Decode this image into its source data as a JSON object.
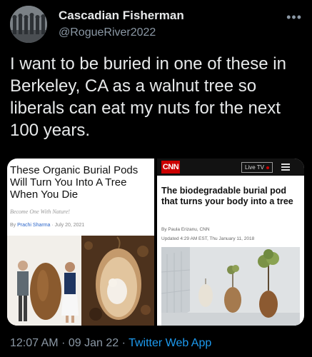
{
  "author": {
    "name": "Cascadian Fisherman",
    "handle": "@RogueRiver2022"
  },
  "menu_icon": "more-dots-icon",
  "tweet": {
    "text": "I want to be buried in one of these in Berkeley, CA as a walnut tree so liberals can eat my nuts for the next 100 years."
  },
  "left_article": {
    "headline": "These Organic Burial Pods Will Turn You Into A Tree When You Die",
    "subhead": "Become One With Nature!",
    "byline_prefix": "By",
    "author": "Prachi Sharma",
    "date": "July 20, 2021"
  },
  "right_article": {
    "logo": "CNN",
    "live_tv": "Live TV",
    "headline": "The biodegradable burial pod that turns your body into a tree",
    "byline": "By Paula Erizanu, CNN",
    "updated": "Updated 4:29 AM EST, Thu January 11, 2018"
  },
  "meta": {
    "time": "12:07 AM",
    "sep1": "·",
    "date": "09 Jan 22",
    "sep2": "·",
    "source": "Twitter Web App"
  },
  "colors": {
    "background": "#000000",
    "text": "#e7e9ea",
    "muted": "#8b98a5",
    "link": "#1d9bf0",
    "cnn_red": "#cc0000"
  }
}
